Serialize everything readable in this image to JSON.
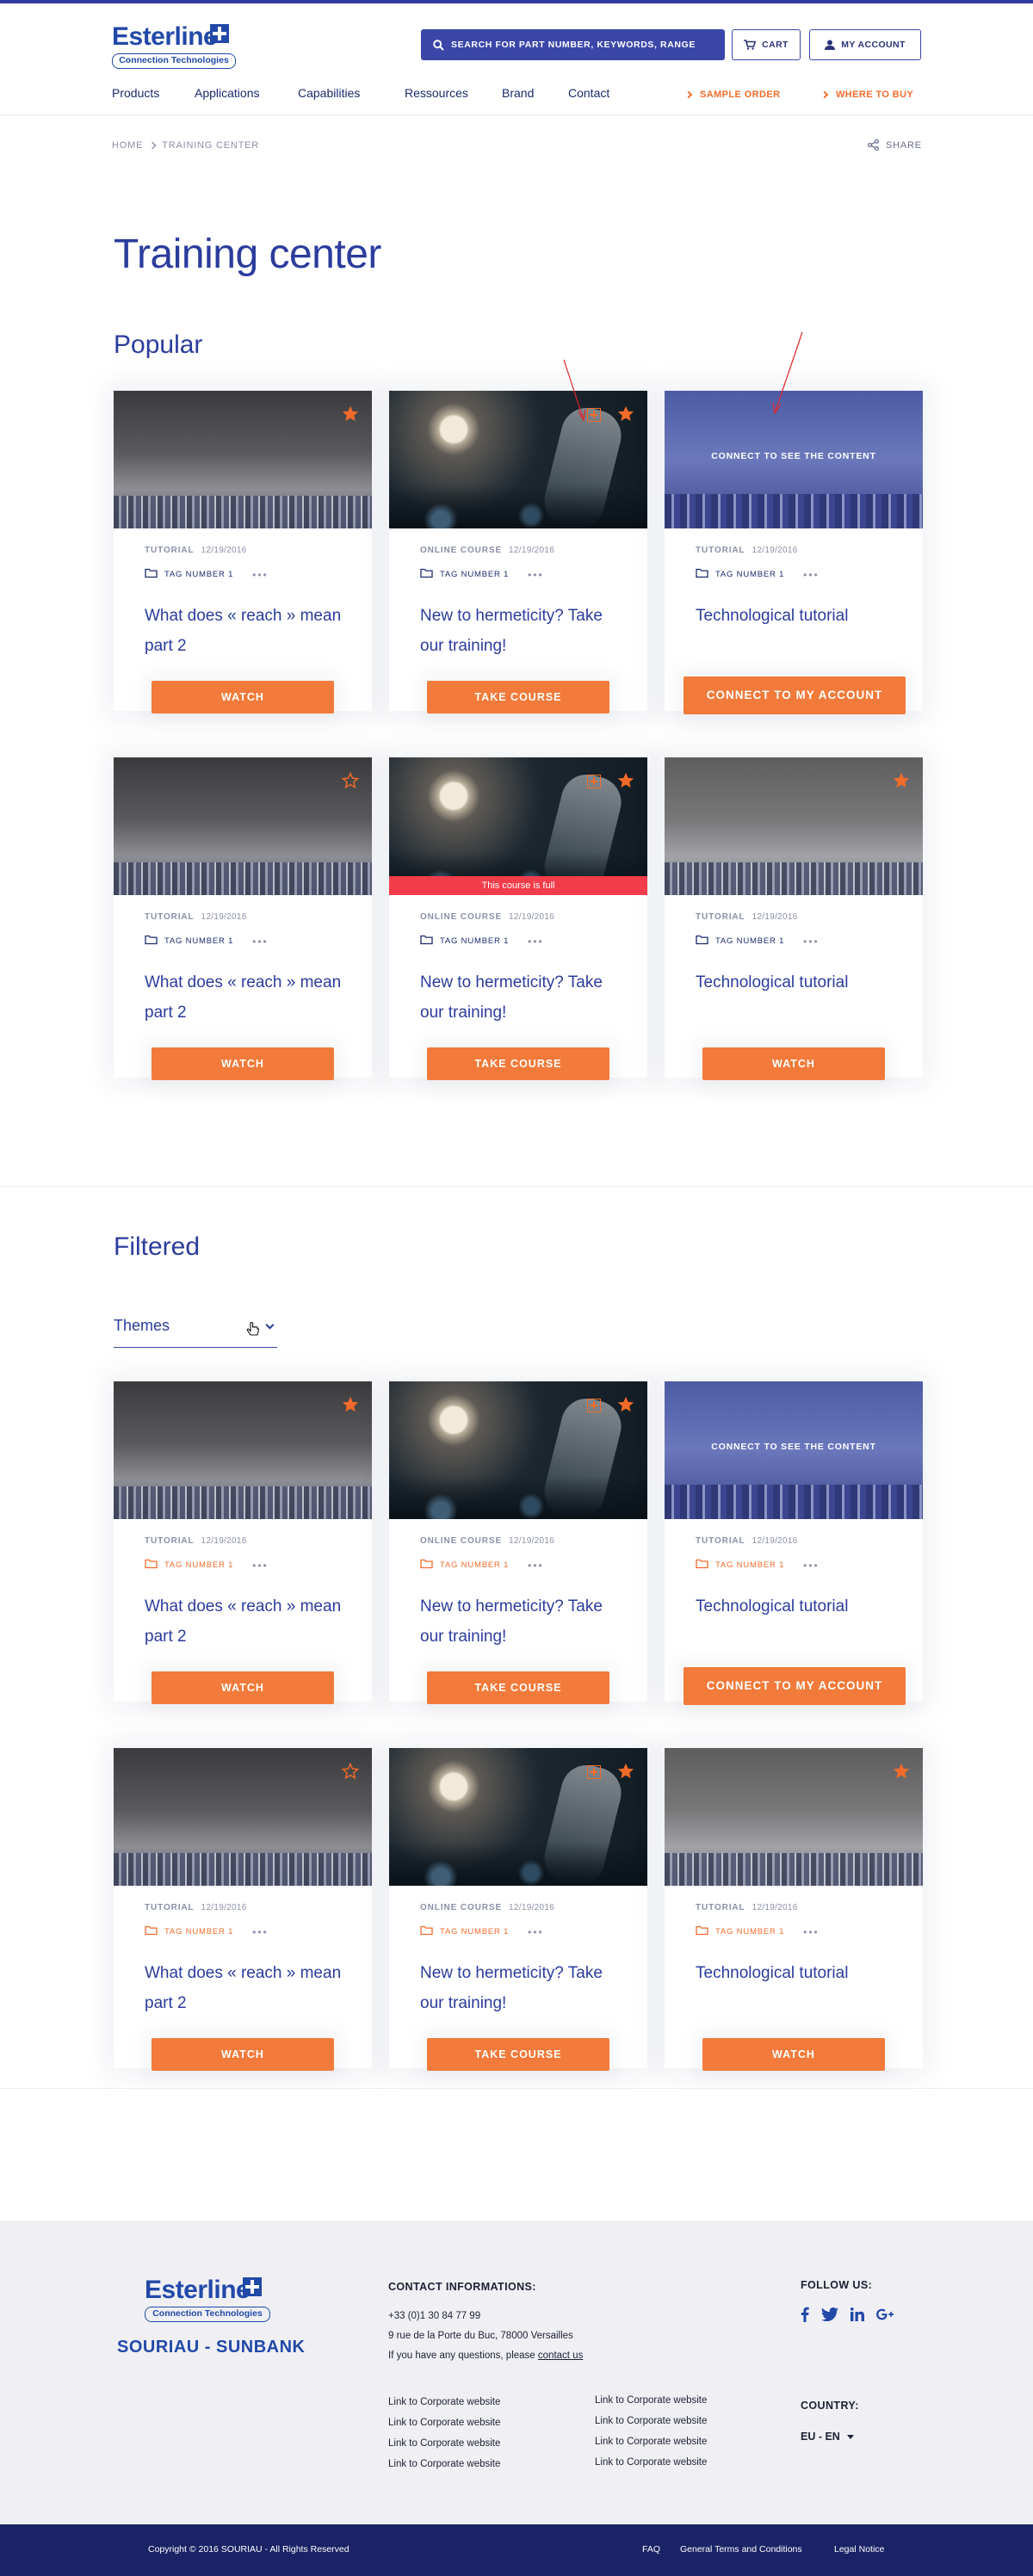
{
  "header": {
    "logo_text": "Esterline",
    "logo_sub": "Connection Technologies",
    "search_label": "Search for part number, keywords, range",
    "cart_label": "Cart",
    "account_label": "My account",
    "nav": [
      "Products",
      "Applications",
      "Capabilities",
      "Ressources",
      "Brand",
      "Contact"
    ],
    "sample_order": "Sample order",
    "where_to_buy": "Where to buy"
  },
  "breadcrumb": {
    "home": "Home",
    "current": "Training center"
  },
  "share_label": "Share",
  "page_title": "Training center",
  "popular": {
    "title": "Popular",
    "cards": [
      {
        "kind": "Tutorial",
        "date": "12/19/2016",
        "tag": "Tag number 1",
        "dots": "•••",
        "title": "What does « reach » mean part 2",
        "button": "Watch"
      },
      {
        "kind": "Online course",
        "date": "12/19/2016",
        "tag": "Tag number 1",
        "dots": "•••",
        "title": "New to hermeticity? Take our training!",
        "button": "Take course"
      },
      {
        "kind": "Tutorial",
        "date": "12/19/2016",
        "tag": "Tag number 1",
        "dots": "•••",
        "title": "Technological tutorial",
        "button": "Connect to my account",
        "overlay": "Connect to see the content"
      },
      {
        "kind": "Tutorial",
        "date": "12/19/2016",
        "tag": "Tag number 1",
        "dots": "•••",
        "title": "What does « reach » mean part 2",
        "button": "Watch"
      },
      {
        "kind": "Online course",
        "date": "12/19/2016",
        "tag": "Tag number 1",
        "dots": "•••",
        "title": "New to hermeticity? Take our training!",
        "button": "Take course",
        "full": "This course is full"
      },
      {
        "kind": "Tutorial",
        "date": "12/19/2016",
        "tag": "Tag number 1",
        "dots": "•••",
        "title": "Technological tutorial",
        "button": "Watch"
      }
    ]
  },
  "filtered": {
    "title": "Filtered",
    "themes_label": "Themes",
    "cards": [
      {
        "kind": "Tutorial",
        "date": "12/19/2016",
        "tag": "Tag number 1",
        "dots": "•••",
        "title": "What does « reach » mean part 2",
        "button": "Watch"
      },
      {
        "kind": "Online course",
        "date": "12/19/2016",
        "tag": "Tag number 1",
        "dots": "•••",
        "title": "New to hermeticity? Take our training!",
        "button": "Take course"
      },
      {
        "kind": "Tutorial",
        "date": "12/19/2016",
        "tag": "Tag number 1",
        "dots": "•••",
        "title": "Technological tutorial",
        "button": "Connect to my account",
        "overlay": "Connect to see the content"
      },
      {
        "kind": "Tutorial",
        "date": "12/19/2016",
        "tag": "Tag number 1",
        "dots": "•••",
        "title": "What does « reach » mean part 2",
        "button": "Watch"
      },
      {
        "kind": "Online course",
        "date": "12/19/2016",
        "tag": "Tag number 1",
        "dots": "•••",
        "title": "New to hermeticity? Take our training!",
        "button": "Take course"
      },
      {
        "kind": "Tutorial",
        "date": "12/19/2016",
        "tag": "Tag number 1",
        "dots": "•••",
        "title": "Technological tutorial",
        "button": "Watch"
      }
    ]
  },
  "footer": {
    "brand": "SOURIAU - SUNBANK",
    "contact_heading": "Contact informations:",
    "phone": "+33 (0)1 30 84 77 99",
    "address": "9 rue de la Porte du Buc, 78000 Versailles",
    "question_prefix": "If you have any questions, please ",
    "contact_link": "contact us",
    "links_col1": [
      "Link to Corporate website",
      "Link to Corporate website",
      "Link to Corporate website",
      "Link to Corporate website"
    ],
    "links_col2": [
      "Link to Corporate website",
      "Link to Corporate website",
      "Link to Corporate website",
      "Link to Corporate website"
    ],
    "follow_heading": "Follow us:",
    "social": [
      "facebook-icon",
      "twitter-icon",
      "linkedin-icon",
      "googleplus-icon"
    ],
    "country_heading": "Country:",
    "country_value": "EU - EN"
  },
  "bottom": {
    "copyright": "Copyright © 2016 SOURIAU - All Rights Reserved",
    "faq": "FAQ",
    "terms": "General Terms and Conditions",
    "legal": "Legal Notice"
  },
  "colors": {
    "brand_blue": "#2149a8",
    "accent_orange": "#f27a3a",
    "nav_blue": "#3a47a8",
    "full_red": "#f23c4a",
    "footer_dark": "#1a2366"
  }
}
